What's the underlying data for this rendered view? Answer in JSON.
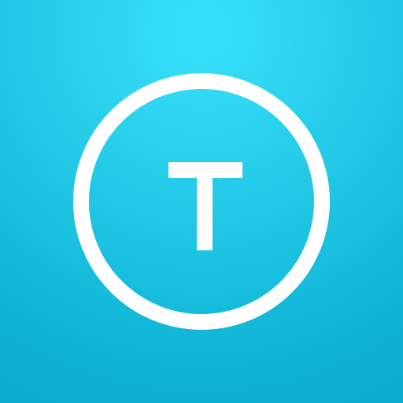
{
  "icon": {
    "name": "t-logo-icon",
    "letter": "T",
    "colors": {
      "background_light": "#38e1fb",
      "background_dark": "#0aaccf",
      "foreground": "#ffffff"
    }
  }
}
